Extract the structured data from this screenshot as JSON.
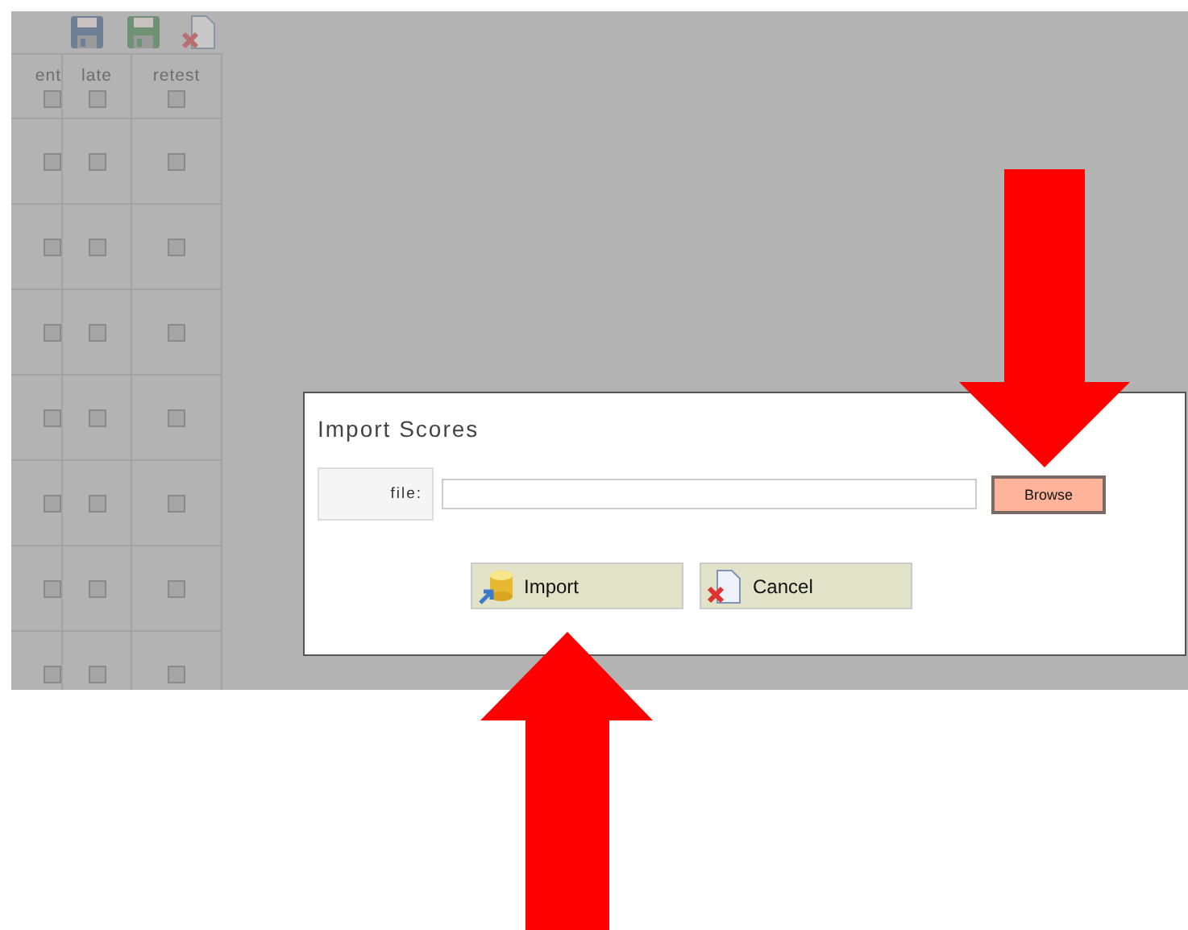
{
  "table": {
    "columns": [
      {
        "label": "ent",
        "checked": false
      },
      {
        "label": "late",
        "checked": false
      },
      {
        "label": "retest",
        "checked": false
      }
    ],
    "rows": [
      {
        "cells": [
          {
            "checked": false
          },
          {
            "checked": false
          },
          {
            "checked": false
          }
        ]
      },
      {
        "cells": [
          {
            "checked": false
          },
          {
            "checked": false
          },
          {
            "checked": false
          }
        ]
      },
      {
        "cells": [
          {
            "checked": false
          },
          {
            "checked": false
          },
          {
            "checked": false
          }
        ]
      },
      {
        "cells": [
          {
            "checked": false
          },
          {
            "checked": false
          },
          {
            "checked": false
          }
        ]
      },
      {
        "cells": [
          {
            "checked": false
          },
          {
            "checked": false
          },
          {
            "checked": false
          }
        ]
      },
      {
        "cells": [
          {
            "checked": false
          },
          {
            "checked": false
          },
          {
            "checked": false
          }
        ]
      },
      {
        "cells": [
          {
            "checked": false
          },
          {
            "checked": false
          },
          {
            "checked": false
          }
        ]
      }
    ]
  },
  "dialog": {
    "title": "Import Scores",
    "field_label": "file:",
    "browse": {
      "label": "Browse",
      "highlighted": true
    },
    "buttons": [
      {
        "kind": "import",
        "label": "Import"
      },
      {
        "kind": "cancel",
        "label": "Cancel"
      }
    ]
  }
}
